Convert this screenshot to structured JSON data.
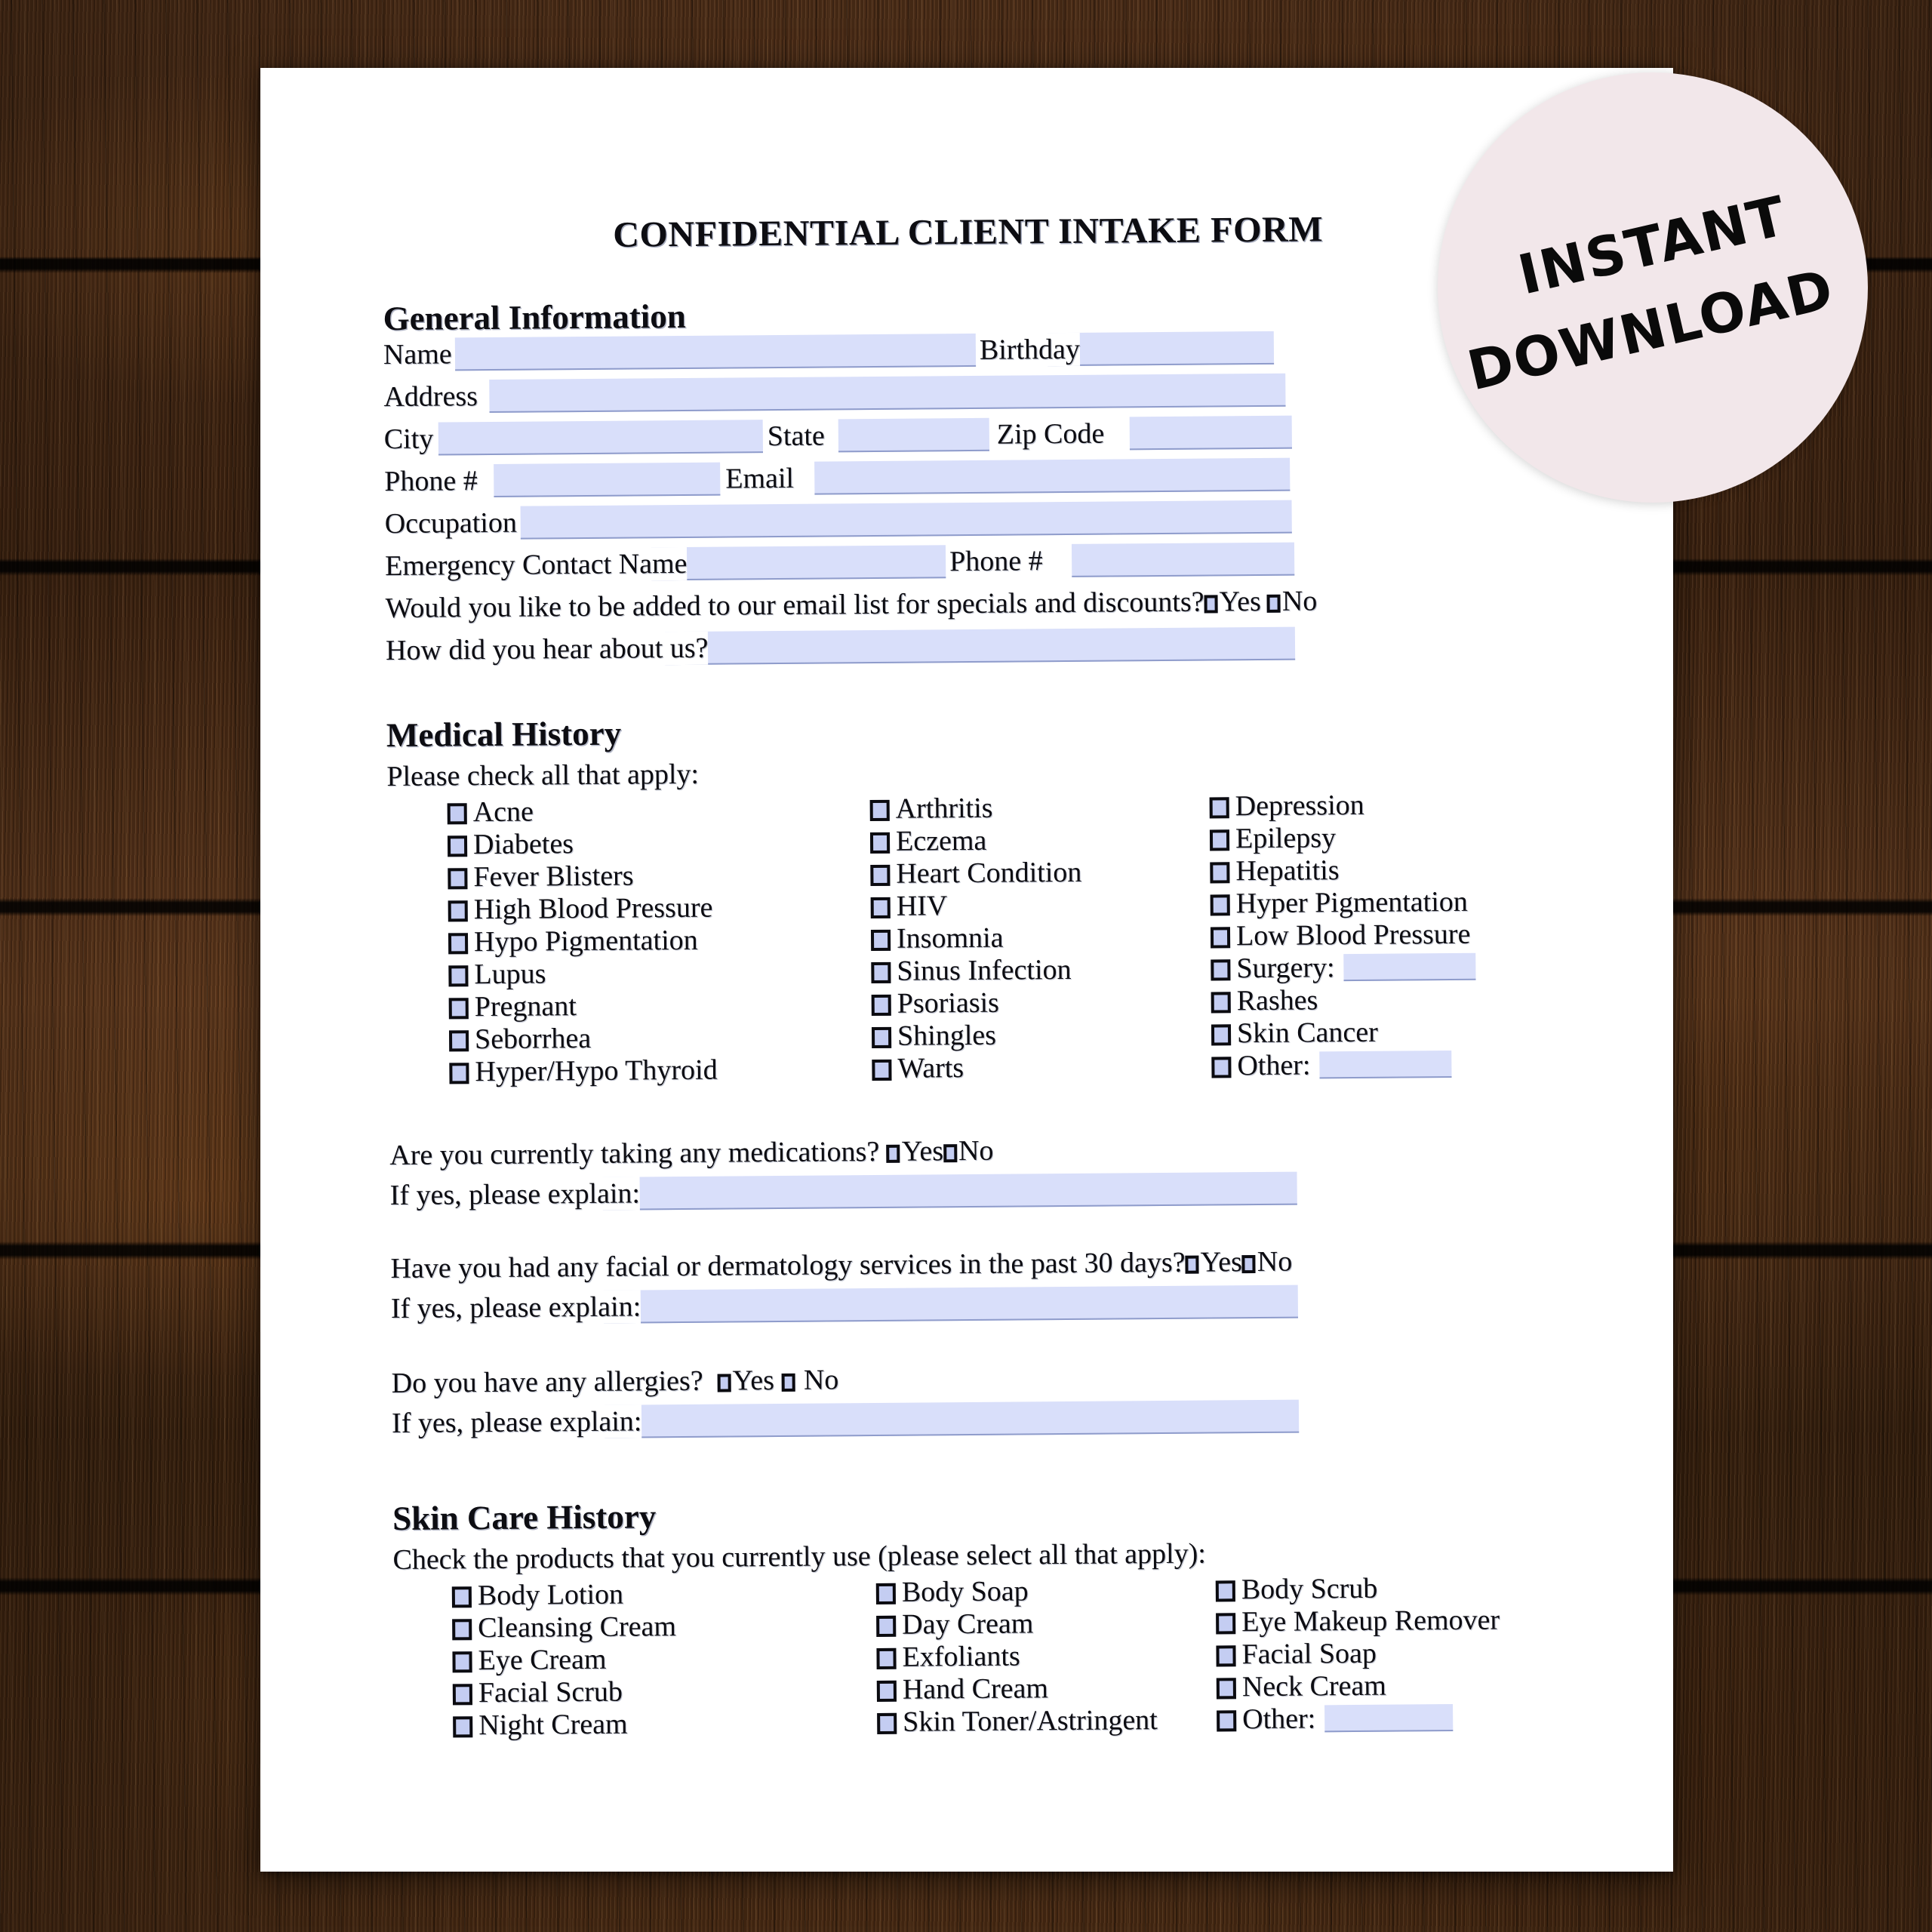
{
  "sticker": {
    "line1": "INSTANT",
    "line2": "DOWNLOAD",
    "bg_color": "#f2e7ea",
    "text_color": "#0a0a0a"
  },
  "document": {
    "title": "CONFIDENTIAL CLIENT INTAKE FORM",
    "field_fill_color": "#d9dffa",
    "field_rule_color": "#8f9ccb",
    "checkbox_fill_color": "#c4cdf2",
    "paper_color": "#ffffff",
    "background_color": "#4a2c16"
  },
  "general_information": {
    "heading": "General Information",
    "labels": {
      "name": "Name",
      "birthday": "Birthday",
      "address": "Address",
      "city": "City",
      "state": "State",
      "zip_code": "Zip Code",
      "phone": "Phone #",
      "email": "Email",
      "occupation": "Occupation",
      "emergency_contact_name": "Emergency Contact Name",
      "emergency_phone": "Phone #"
    },
    "values": {
      "name": "",
      "birthday": "",
      "address": "",
      "city": "",
      "state": "",
      "zip_code": "",
      "phone": "",
      "email": "",
      "occupation": "",
      "emergency_contact_name": "",
      "emergency_phone": "",
      "how_did_you_hear": ""
    },
    "email_list_question": {
      "text": "Would you like to be added to our email list for specials and discounts?",
      "yes_label": "Yes",
      "no_label": "No",
      "selected": ""
    },
    "how_heard_question": {
      "text": "How did you hear about us?"
    }
  },
  "medical_history": {
    "heading": "Medical History",
    "instruction": "Please check all that apply:",
    "columns": [
      {
        "items": [
          {
            "label": "Acne",
            "checked": false
          },
          {
            "label": "Diabetes",
            "checked": false
          },
          {
            "label": "Fever Blisters",
            "checked": false
          },
          {
            "label": "High Blood Pressure",
            "checked": false
          },
          {
            "label": "Hypo Pigmentation",
            "checked": false
          },
          {
            "label": "Lupus",
            "checked": false
          },
          {
            "label": "Pregnant",
            "checked": false
          },
          {
            "label": "Seborrhea",
            "checked": false
          },
          {
            "label": "Hyper/Hypo Thyroid",
            "checked": false
          }
        ]
      },
      {
        "items": [
          {
            "label": "Arthritis",
            "checked": false
          },
          {
            "label": "Eczema",
            "checked": false
          },
          {
            "label": "Heart Condition",
            "checked": false
          },
          {
            "label": "HIV",
            "checked": false
          },
          {
            "label": "Insomnia",
            "checked": false
          },
          {
            "label": "Sinus Infection",
            "checked": false
          },
          {
            "label": "Psoriasis",
            "checked": false
          },
          {
            "label": "Shingles",
            "checked": false
          },
          {
            "label": "Warts",
            "checked": false
          }
        ]
      },
      {
        "items": [
          {
            "label": "Depression",
            "checked": false
          },
          {
            "label": "Epilepsy",
            "checked": false
          },
          {
            "label": "Hepatitis",
            "checked": false
          },
          {
            "label": "Hyper Pigmentation",
            "checked": false
          },
          {
            "label": "Low Blood Pressure",
            "checked": false
          },
          {
            "label": "Surgery:",
            "checked": false,
            "has_field": true,
            "value": ""
          },
          {
            "label": "Rashes",
            "checked": false
          },
          {
            "label": "Skin Cancer",
            "checked": false
          },
          {
            "label": "Other:",
            "checked": false,
            "has_field": true,
            "value": ""
          }
        ]
      }
    ],
    "questions": [
      {
        "text": "Are you currently taking any medications?",
        "yes_label": "Yes",
        "no_label": "No",
        "selected": "",
        "followup_label": "If yes, please explain:",
        "followup_value": ""
      },
      {
        "text": "Have you had any facial or dermatology services in the past 30 days?",
        "yes_label": "Yes",
        "no_label": "No",
        "selected": "",
        "followup_label": "If yes, please explain:",
        "followup_value": ""
      },
      {
        "text": "Do you have any allergies?",
        "yes_label": "Yes",
        "no_label": "No",
        "selected": "",
        "followup_label": "If yes, please explain:",
        "followup_value": ""
      }
    ]
  },
  "skin_care_history": {
    "heading": "Skin Care History",
    "instruction": "Check the products that you currently use (please select all that apply):",
    "columns": [
      {
        "items": [
          {
            "label": "Body Lotion",
            "checked": false
          },
          {
            "label": "Cleansing Cream",
            "checked": false
          },
          {
            "label": "Eye Cream",
            "checked": false
          },
          {
            "label": "Facial Scrub",
            "checked": false
          },
          {
            "label": "Night Cream",
            "checked": false
          }
        ]
      },
      {
        "items": [
          {
            "label": "Body Soap",
            "checked": false
          },
          {
            "label": "Day Cream",
            "checked": false
          },
          {
            "label": "Exfoliants",
            "checked": false
          },
          {
            "label": "Hand Cream",
            "checked": false
          },
          {
            "label": "Skin Toner/Astringent",
            "checked": false
          }
        ]
      },
      {
        "items": [
          {
            "label": "Body Scrub",
            "checked": false
          },
          {
            "label": "Eye Makeup Remover",
            "checked": false
          },
          {
            "label": "Facial Soap",
            "checked": false
          },
          {
            "label": "Neck Cream",
            "checked": false
          },
          {
            "label": "Other:",
            "checked": false,
            "has_field": true,
            "value": ""
          }
        ]
      }
    ]
  }
}
